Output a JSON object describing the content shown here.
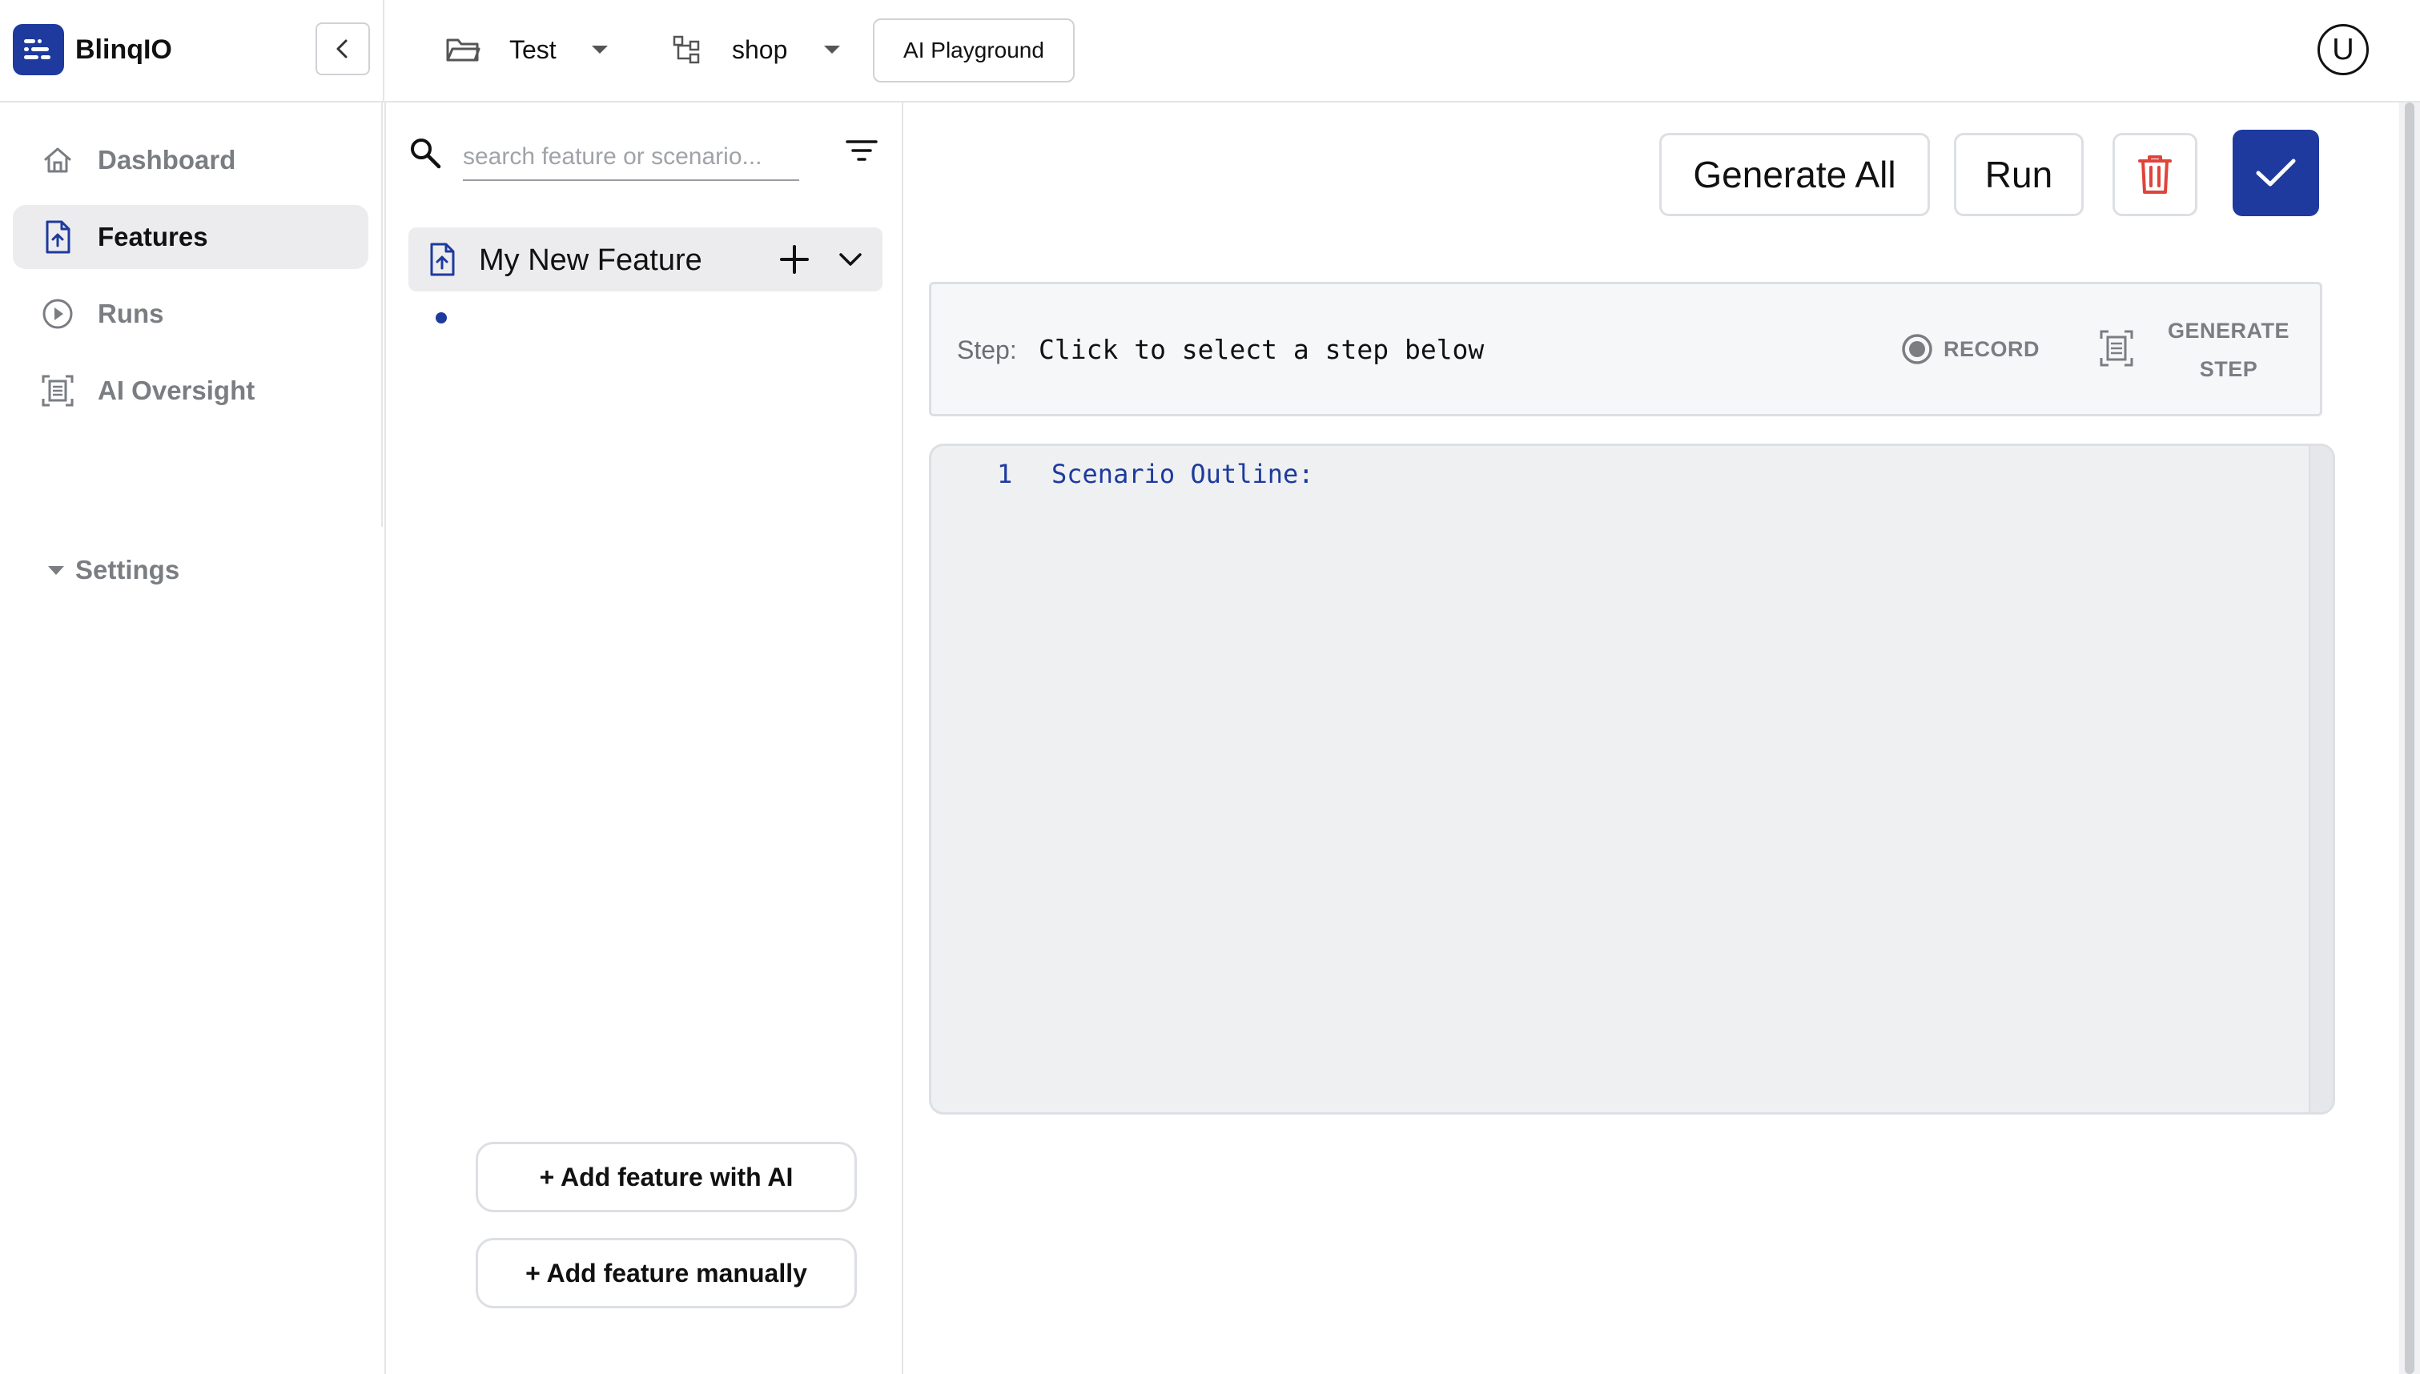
{
  "app": {
    "name": "BlinqIO"
  },
  "header": {
    "project": "Test",
    "repository": "shop",
    "ai_playground": "AI Playground",
    "user_initial": "U"
  },
  "sidebar": {
    "items": [
      {
        "label": "Dashboard",
        "icon": "home-icon",
        "active": false
      },
      {
        "label": "Features",
        "icon": "feature-file-icon",
        "active": true
      },
      {
        "label": "Runs",
        "icon": "play-circle-icon",
        "active": false
      },
      {
        "label": "AI Oversight",
        "icon": "ai-oversight-icon",
        "active": false
      }
    ],
    "settings_label": "Settings"
  },
  "features_panel": {
    "search_placeholder": "search feature or scenario...",
    "feature_name": "My New Feature",
    "add_with_ai": "+ Add feature with AI",
    "add_manually": "+ Add feature manually"
  },
  "toolbar": {
    "generate_all": "Generate All",
    "run": "Run"
  },
  "step_bar": {
    "label": "Step:",
    "text": "Click to select a step below",
    "record": "RECORD",
    "generate_step": "GENERATE STEP"
  },
  "editor": {
    "line_number": "1",
    "line_text": "Scenario Outline:"
  },
  "colors": {
    "accent": "#1e3a9e",
    "delete": "#e0433a",
    "muted_text": "#7a7d82"
  }
}
